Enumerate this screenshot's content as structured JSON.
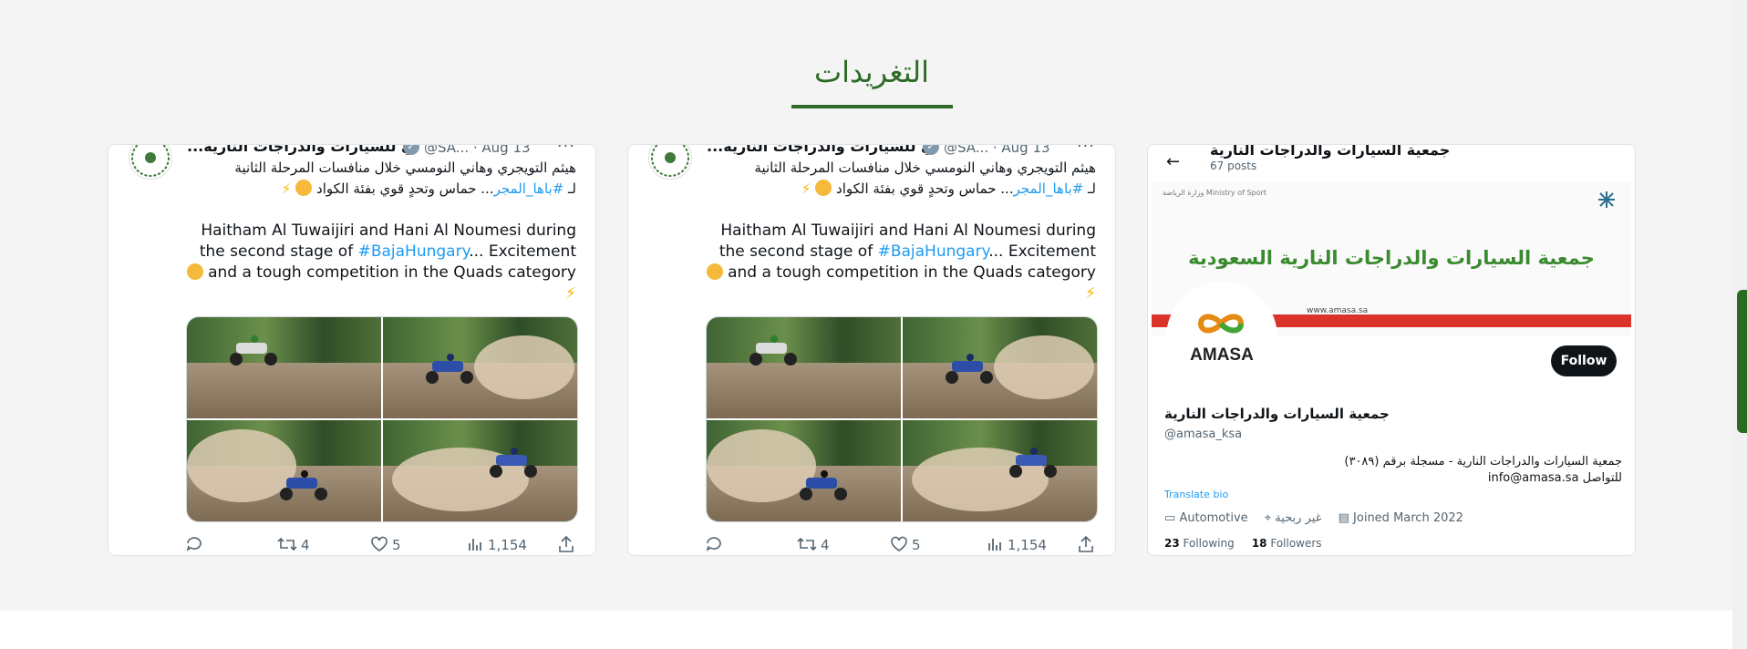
{
  "section": {
    "title": "التغريدات",
    "accent_color": "#2e6b27"
  },
  "tweets": [
    {
      "name": "...ي للسيارات والدراجات النارية",
      "handle": "@SA... · Aug 13",
      "more": "···",
      "arabic_line1": "هيثم التويجري وهاني النومسي خلال منافسات المرحلة الثانية",
      "arabic_line2_prefix": "لـ ",
      "arabic_hashtag": "#باها_المجر",
      "arabic_line2_suffix": "... حماس وتحدٍ قوي بفئة الكواد",
      "english_line1": "Haitham Al Tuwaijiri and Hani Al Noumesi during",
      "english_line2_prefix": "the second stage of ",
      "english_hashtag": "#BajaHungary",
      "english_line2_suffix": "... Excitement",
      "english_line3": "and a tough competition in the Quads category",
      "retweets": "4",
      "likes": "5",
      "views": "1,154"
    },
    {
      "name": "...ي للسيارات والدراجات النارية",
      "handle": "@SA... · Aug 13",
      "more": "···",
      "arabic_line1": "هيثم التويجري وهاني النومسي خلال منافسات المرحلة الثانية",
      "arabic_line2_prefix": "لـ ",
      "arabic_hashtag": "#باها_المجر",
      "arabic_line2_suffix": "... حماس وتحدٍ قوي بفئة الكواد",
      "english_line1": "Haitham Al Tuwaijiri and Hani Al Noumesi during",
      "english_line2_prefix": "the second stage of ",
      "english_hashtag": "#BajaHungary",
      "english_line2_suffix": "... Excitement",
      "english_line3": "and a tough competition in the Quads category",
      "retweets": "4",
      "likes": "5",
      "views": "1,154"
    }
  ],
  "profile": {
    "title": "جمعية السيارات والدراجات النارية",
    "posts": "67 posts",
    "banner_title": "جمعية السيارات والدراجات النارية السعودية",
    "banner_logo_left": "وزارة الرياضة Ministry of Sport",
    "banner_website": "www.amasa.sa",
    "avatar_text": "AMASA",
    "follow_label": "Follow",
    "name": "جمعية السيارات والدراجات النارية",
    "handle": "@amasa_ksa",
    "bio_line1": "جمعية السيارات والدراجات النارية - مسجلة برقم (٣٠٨٩)",
    "bio_line2": "للتواصل info@amasa.sa",
    "translate": "Translate bio",
    "category": "Automotive",
    "location": "غير ربحية",
    "joined": "Joined March 2022",
    "following_count": "23",
    "following_label": "Following",
    "followers_count": "18",
    "followers_label": "Followers"
  }
}
